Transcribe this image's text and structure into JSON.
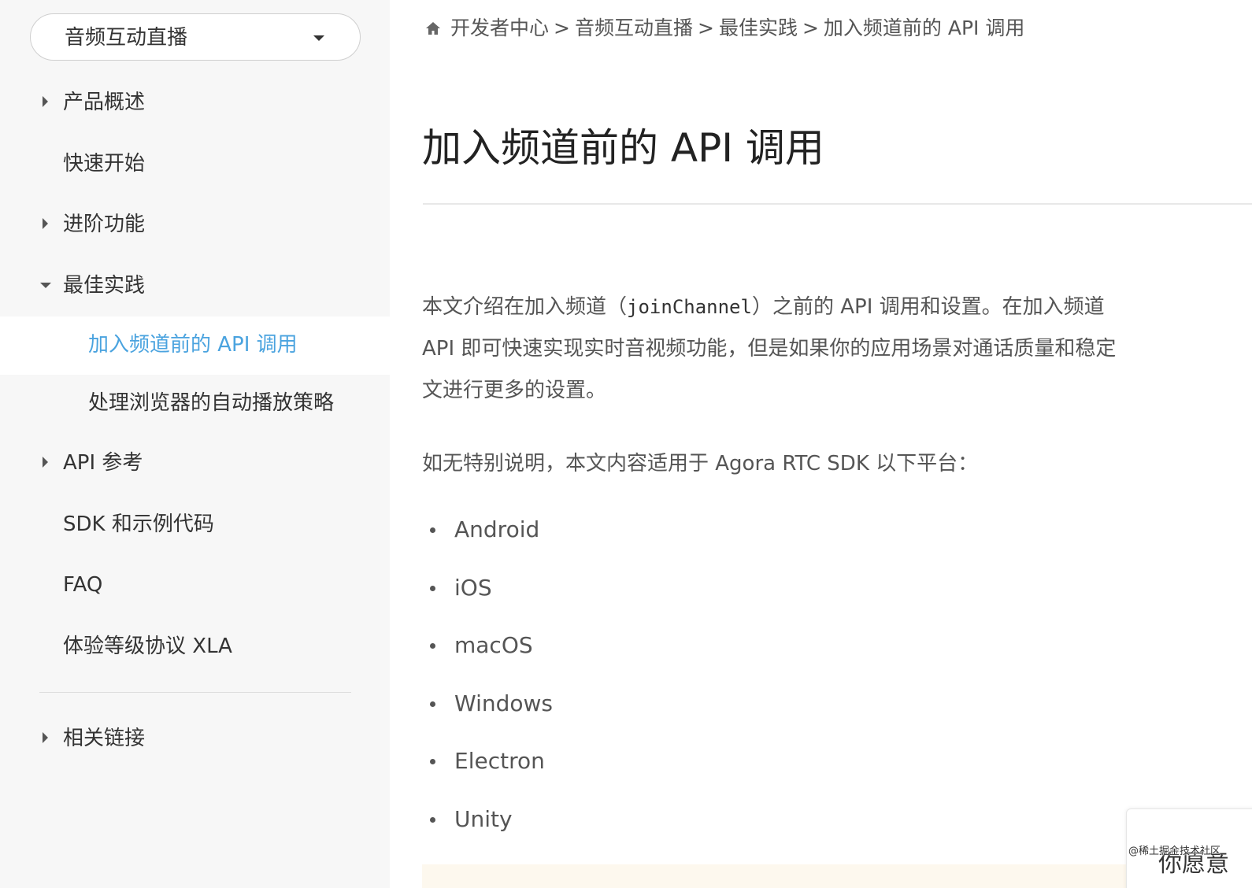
{
  "sidebar": {
    "product_select": {
      "value": "音频互动直播",
      "icon": "caret-down-icon"
    },
    "items": [
      {
        "label": "产品概述",
        "caret": "right"
      },
      {
        "label": "快速开始",
        "caret": "none"
      },
      {
        "label": "进阶功能",
        "caret": "right"
      },
      {
        "label": "最佳实践",
        "caret": "down"
      }
    ],
    "sub_items": [
      {
        "label": "加入频道前的 API 调用",
        "active": true
      },
      {
        "label": "处理浏览器的自动播放策略",
        "active": false
      }
    ],
    "items_after": [
      {
        "label": "API 参考",
        "caret": "right"
      },
      {
        "label": "SDK 和示例代码",
        "caret": "none"
      },
      {
        "label": "FAQ",
        "caret": "none"
      },
      {
        "label": "体验等级协议 XLA",
        "caret": "none"
      }
    ],
    "related": {
      "label": "相关链接",
      "caret": "right"
    }
  },
  "breadcrumb": {
    "home_icon": "home-icon",
    "items": [
      "开发者中心",
      "音频互动直播",
      "最佳实践"
    ],
    "separator": ">",
    "current": "加入频道前的 API 调用"
  },
  "article": {
    "title": "加入频道前的 API 调用",
    "intro": {
      "line1_before": "本文介绍在加入频道（",
      "line1_code": "joinChannel",
      "line1_after": "）之前的 API 调用和设置。在加入频道",
      "line2": "API 即可快速实现实时音视频功能，但是如果你的应用场景对通话质量和稳定",
      "line3": "文进行更多的设置。"
    },
    "applies_to": "如无特别说明，本文内容适用于 Agora RTC SDK 以下平台：",
    "platforms": [
      "Android",
      "iOS",
      "macOS",
      "Windows",
      "Electron",
      "Unity"
    ]
  },
  "feedback_widget": {
    "text": "你愿意"
  },
  "watermark": "@稀土掘金技术社区",
  "colors": {
    "sidebar_bg": "#f7f7f7",
    "active_link": "#4aa3df",
    "text": "#333333",
    "muted_text": "#555555",
    "notice_bg": "#fdf8ee"
  }
}
